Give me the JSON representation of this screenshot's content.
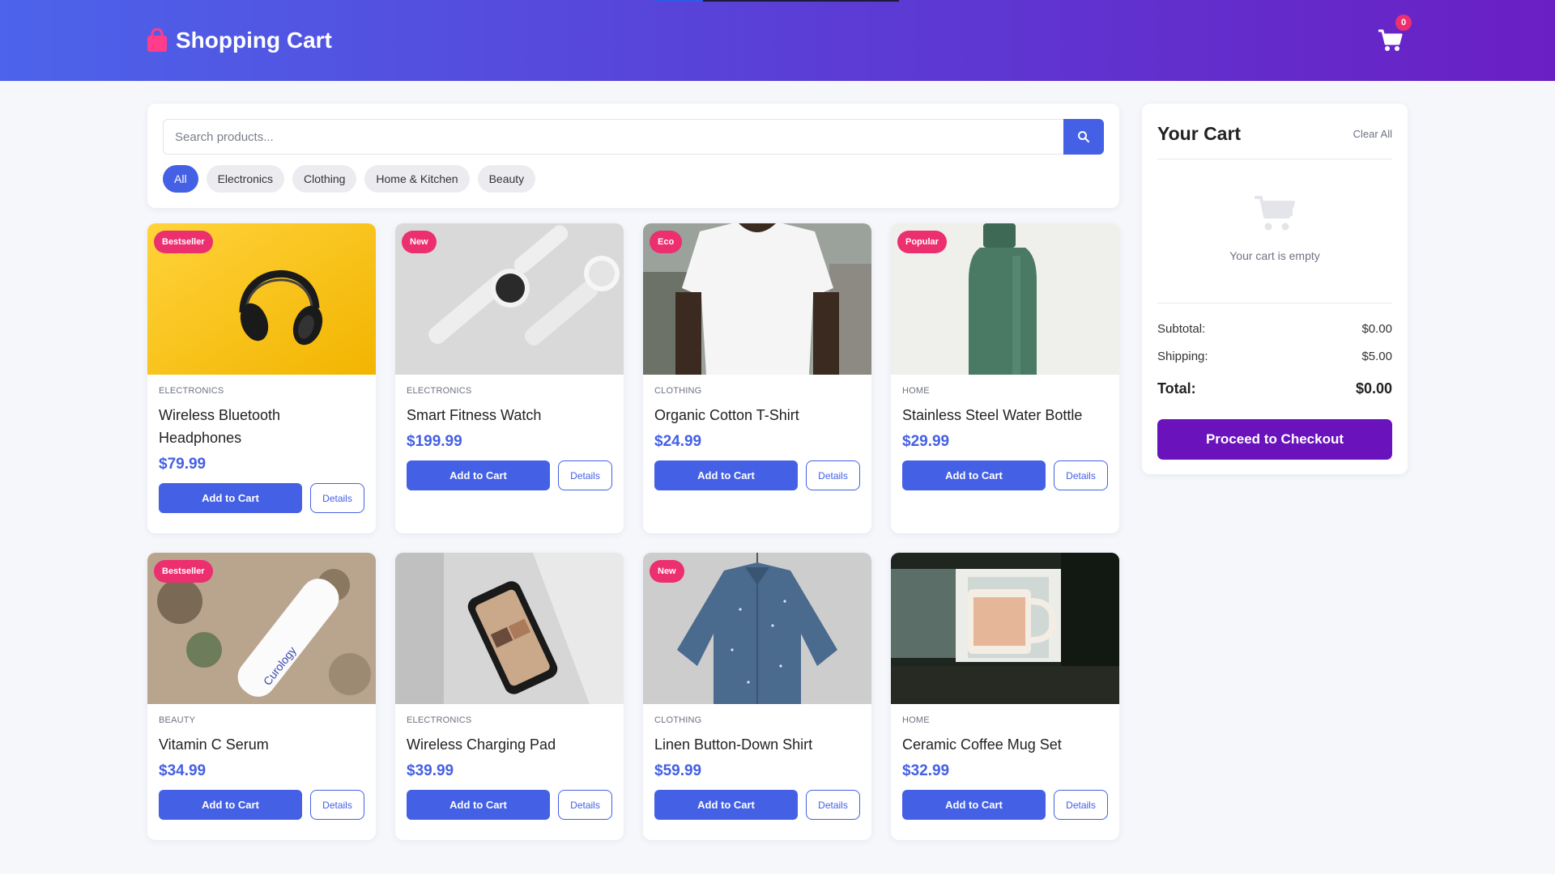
{
  "header": {
    "title": "Shopping Cart",
    "cart_count": "0",
    "brand_icon": "shopping-bag-icon",
    "cart_icon": "cart-icon"
  },
  "search": {
    "placeholder": "Search products...",
    "value": ""
  },
  "filters": [
    "All",
    "Electronics",
    "Clothing",
    "Home & Kitchen",
    "Beauty"
  ],
  "active_filter": "All",
  "products": [
    {
      "badge": "Bestseller",
      "category": "ELECTRONICS",
      "name": "Wireless Bluetooth Headphones",
      "price": "$79.99",
      "add_label": "Add to Cart",
      "details_label": "Details"
    },
    {
      "badge": "New",
      "category": "ELECTRONICS",
      "name": "Smart Fitness Watch",
      "price": "$199.99",
      "add_label": "Add to Cart",
      "details_label": "Details"
    },
    {
      "badge": "Eco",
      "category": "CLOTHING",
      "name": "Organic Cotton T-Shirt",
      "price": "$24.99",
      "add_label": "Add to Cart",
      "details_label": "Details"
    },
    {
      "badge": "Popular",
      "category": "HOME",
      "name": "Stainless Steel Water Bottle",
      "price": "$29.99",
      "add_label": "Add to Cart",
      "details_label": "Details"
    },
    {
      "badge": "Bestseller",
      "category": "BEAUTY",
      "name": "Vitamin C Serum",
      "price": "$34.99",
      "add_label": "Add to Cart",
      "details_label": "Details"
    },
    {
      "badge": "",
      "category": "ELECTRONICS",
      "name": "Wireless Charging Pad",
      "price": "$39.99",
      "add_label": "Add to Cart",
      "details_label": "Details"
    },
    {
      "badge": "New",
      "category": "CLOTHING",
      "name": "Linen Button-Down Shirt",
      "price": "$59.99",
      "add_label": "Add to Cart",
      "details_label": "Details"
    },
    {
      "badge": "",
      "category": "HOME",
      "name": "Ceramic Coffee Mug Set",
      "price": "$32.99",
      "add_label": "Add to Cart",
      "details_label": "Details"
    }
  ],
  "cart": {
    "title": "Your Cart",
    "clear_label": "Clear All",
    "empty_text": "Your cart is empty",
    "subtotal_label": "Subtotal:",
    "subtotal_value": "$0.00",
    "shipping_label": "Shipping:",
    "shipping_value": "$5.00",
    "total_label": "Total:",
    "total_value": "$0.00",
    "checkout_label": "Proceed to Checkout"
  },
  "colors": {
    "primary": "#4460e4",
    "badge": "#ec2f6f",
    "checkout": "#6a12bb",
    "header_start": "#4c63ea",
    "header_end": "#6a1fc4"
  }
}
